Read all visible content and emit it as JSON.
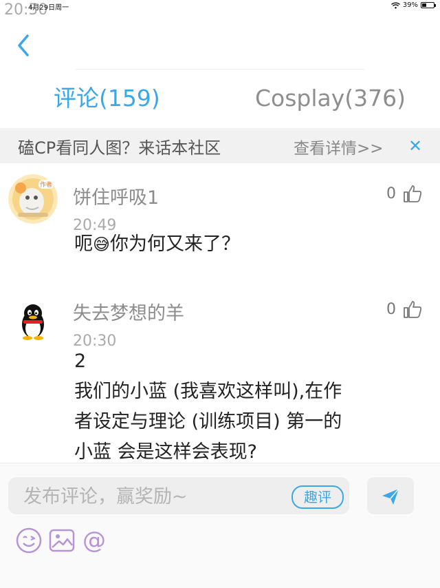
{
  "status_bar": {
    "time": "20:50",
    "date": "4月29日周一",
    "battery": "39%",
    "battery_level": 0.39
  },
  "tabs": [
    {
      "label": "评论(159)",
      "active": true
    },
    {
      "label": "Cosplay(376)",
      "active": false
    }
  ],
  "banner": {
    "text": "磕CP看同人图？来话本社区",
    "link": "查看详情>>"
  },
  "comments": [
    {
      "username": "饼住呼吸1",
      "time": "20:49",
      "likes": "0",
      "text_before": "呃",
      "text_emoji": "😅",
      "text_after": "你为何又来了？",
      "avatar_badge": "作者"
    },
    {
      "username": "失去梦想的羊",
      "time": "20:30",
      "likes": "0",
      "lines": [
        "2",
        "我们的小蓝 (我喜欢这样叫),在作",
        "者设定与理论 (训练项目) 第一的",
        "小蓝 会是这样会表现?"
      ]
    }
  ],
  "input": {
    "placeholder": "发布评论，赢奖励~",
    "qupin_label": "趣评"
  },
  "toolbar": {
    "emoji": "emoji-icon",
    "image": "image-icon",
    "mention": "@"
  },
  "colors": {
    "accent": "#3aa7e8",
    "tool_purple": "#b693d8"
  }
}
